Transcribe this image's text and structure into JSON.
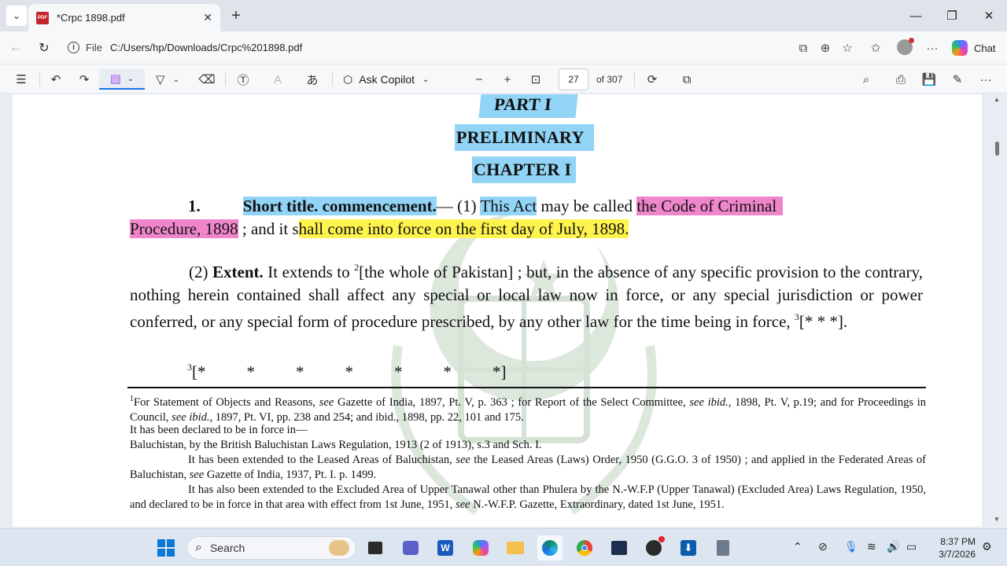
{
  "browser": {
    "tab_title": "*Crpc 1898.pdf",
    "url_scheme": "File",
    "url": "C:/Users/hp/Downloads/Crpc%201898.pdf",
    "chat_label": "Chat"
  },
  "toolbar": {
    "ask_copilot_label": "Ask Copilot",
    "current_page": "27",
    "total_pages_label": "of 307"
  },
  "document": {
    "part": "PART I",
    "preliminary": "PRELIMINARY",
    "chapter": "CHAPTER I",
    "section_number": "1.",
    "section_title": "Short title. commencement.",
    "s1_dash": "— (1) ",
    "s1_this_act": "This Act",
    "s1_may_be_called": " may be called ",
    "s1_code_name_1": "the Code of Criminal",
    "s1_code_name_2": "Procedure, 1898",
    "s1_semicolon": " ; and it s",
    "s1_commencement": "hall come into force on the first day of July, 1898.",
    "s2_number": "(2) ",
    "s2_title": "Extent.",
    "s2_text_a": " It extends to ",
    "s2_fn2": "2",
    "s2_text_b": "[the whole of Pakistan] ; but, in the absence of any specific provision to the contrary, nothing herein contained shall affect any special or local law now in force, or any special jurisdiction or power conferred, or any special form of procedure prescribed, by any other law for the time being in force, ",
    "s2_fn3": "3",
    "s2_text_c": "[* * *].",
    "stars_fn": "3",
    "stars_open": "[*",
    "star": "*",
    "stars_close": "*]",
    "footnote_1_marker": "1",
    "footnote_1a": "For Statement of Objects and Reasons, ",
    "see": "see",
    "footnote_1b": " Gazette of India, 1897, Pt. V, p. 363 ; for Report of the Select Committee, ",
    "ibid": "ibid.",
    "footnote_1c": ", 1898, Pt. V, p.19; and for Proceedings in Council, ",
    "footnote_1d": ", 1897, Pt. VI, pp. 238 and 254; and ibid., 1898, pp. 22, 101 and 175.",
    "footnote_2": "It has been declared to be in force in—",
    "footnote_3": "Baluchistan, by the British Baluchistan Laws Regulation, 1913 (2 of 1913), s.3 and Sch. I.",
    "footnote_4a": "It has been extended to the Leased Areas of Baluchistan, ",
    "footnote_4b": " the Leased Areas (Laws) Order, 1950 (G.G.O. 3 of 1950) ; and applied in the Federated Areas of Baluchistan, ",
    "footnote_4c": " Gazette of India, 1937, Pt. I. p. 1499.",
    "footnote_5a": "It has also been extended to the Excluded Area of Upper Tanawal other than Phulera by the N.-W.F.P (Upper Tanawal) (Excluded Area) Laws Regulation, 1950, and declared to be in force in  that area with effect from 1st June, 1951, ",
    "footnote_5b": " N.-W.F.P. Gazette, Extraordinary, dated 1st June, 1951."
  },
  "taskbar": {
    "search_placeholder": "Search",
    "time": "8:37 PM",
    "date": "3/7/2026"
  },
  "colors": {
    "highlight_blue": "#92d4f6",
    "highlight_pink": "#ef86cc",
    "highlight_yellow": "#fff34d",
    "accent": "#1a73e8"
  }
}
